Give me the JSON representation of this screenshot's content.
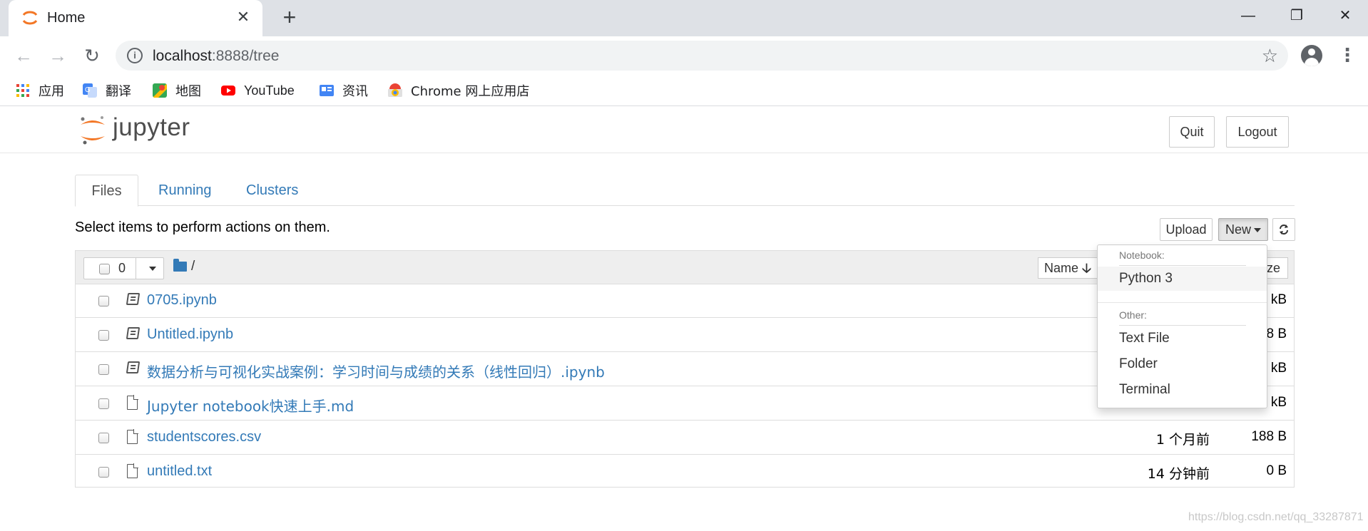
{
  "browser": {
    "tab_title": "Home",
    "tab_close": "✕",
    "new_tab": "+",
    "url_host": "localhost",
    "url_rest": ":8888/tree",
    "back": "←",
    "forward": "→",
    "reload": "↻",
    "star": "☆",
    "menu": "⋮",
    "window_minimize": "—",
    "window_restore": "❐",
    "window_close": "✕"
  },
  "bookmarks": [
    {
      "label": "应用",
      "icon": "apps-grid-icon",
      "color": "#4285f4"
    },
    {
      "label": "翻译",
      "icon": "translate-icon",
      "color": "#4285f4"
    },
    {
      "label": "地图",
      "icon": "maps-icon",
      "color": "#34a853"
    },
    {
      "label": "YouTube",
      "icon": "youtube-icon",
      "color": "#ff0000"
    },
    {
      "label": "资讯",
      "icon": "news-icon",
      "color": "#4285f4"
    },
    {
      "label": "Chrome 网上应用店",
      "icon": "webstore-icon",
      "color": "#ea4335"
    }
  ],
  "jupyter": {
    "brand": "jupyter",
    "quit_label": "Quit",
    "logout_label": "Logout",
    "brand_color": "#f37726",
    "tabs": [
      {
        "label": "Files",
        "active": true
      },
      {
        "label": "Running",
        "active": false
      },
      {
        "label": "Clusters",
        "active": false
      }
    ],
    "hint": "Select items to perform actions on them.",
    "upload_label": "Upload",
    "new_label": "New",
    "refresh_icon": "refresh-icon",
    "selected_count": "0",
    "breadcrumb": "/",
    "sort_label": "Name",
    "sort_arrow": "🡣",
    "size_header_fragment": "ze"
  },
  "files": [
    {
      "name": "0705.ipynb",
      "type": "notebook",
      "modified": "",
      "size": "kB"
    },
    {
      "name": "Untitled.ipynb",
      "type": "notebook",
      "modified": "",
      "size": "8 B"
    },
    {
      "name": "数据分析与可视化实战案例：学习时间与成绩的关系（线性回归）.ipynb",
      "type": "notebook",
      "modified": "",
      "size": "kB"
    },
    {
      "name": "Jupyter notebook快速上手.md",
      "type": "file",
      "modified": "",
      "size": "kB"
    },
    {
      "name": "studentscores.csv",
      "type": "file",
      "modified": "1 个月前",
      "size": "188 B"
    },
    {
      "name": "untitled.txt",
      "type": "file",
      "modified": "14 分钟前",
      "size": "0 B"
    }
  ],
  "new_menu": {
    "notebook_header": "Notebook:",
    "notebook_items": [
      "Python 3"
    ],
    "other_header": "Other:",
    "other_items": [
      "Text File",
      "Folder",
      "Terminal"
    ]
  },
  "watermark": "https://blog.csdn.net/qq_33287871"
}
